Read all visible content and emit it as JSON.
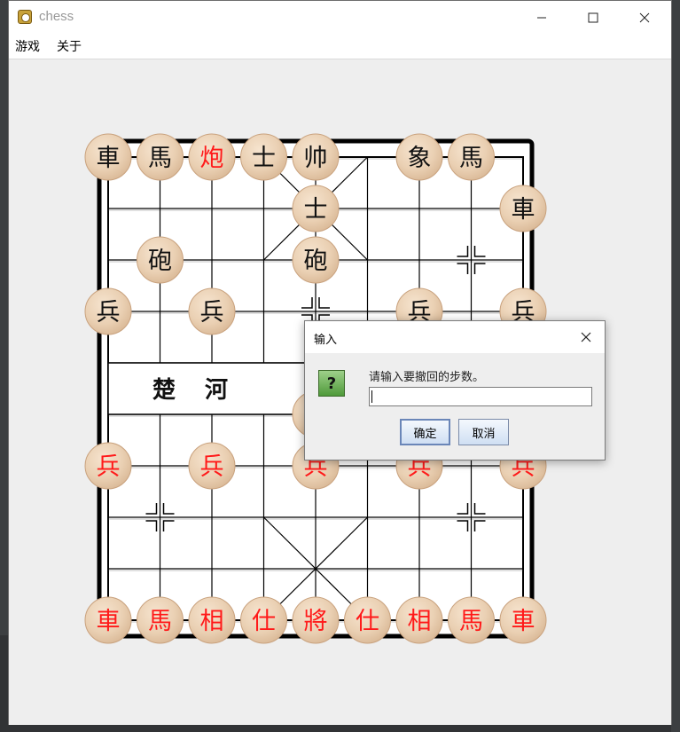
{
  "window": {
    "title": "chess",
    "menu": [
      "游戏",
      "关于"
    ]
  },
  "board": {
    "river_text_left": "楚 河",
    "pieces": [
      {
        "label": "車",
        "color": "black",
        "col": 0,
        "row": 0
      },
      {
        "label": "馬",
        "color": "black",
        "col": 1,
        "row": 0
      },
      {
        "label": "炮",
        "color": "red",
        "col": 2,
        "row": 0
      },
      {
        "label": "士",
        "color": "black",
        "col": 3,
        "row": 0
      },
      {
        "label": "帅",
        "color": "black",
        "col": 4,
        "row": 0
      },
      {
        "label": "象",
        "color": "black",
        "col": 6,
        "row": 0
      },
      {
        "label": "馬",
        "color": "black",
        "col": 7,
        "row": 0
      },
      {
        "label": "士",
        "color": "black",
        "col": 4,
        "row": 1
      },
      {
        "label": "車",
        "color": "black",
        "col": 8,
        "row": 1
      },
      {
        "label": "砲",
        "color": "black",
        "col": 1,
        "row": 2
      },
      {
        "label": "砲",
        "color": "black",
        "col": 4,
        "row": 2
      },
      {
        "label": "兵",
        "color": "black",
        "col": 0,
        "row": 3
      },
      {
        "label": "兵",
        "color": "black",
        "col": 2,
        "row": 3
      },
      {
        "label": "兵",
        "color": "black",
        "col": 6,
        "row": 3
      },
      {
        "label": "兵",
        "color": "black",
        "col": 8,
        "row": 3
      },
      {
        "label": "炮",
        "color": "red",
        "col": 4,
        "row": 5
      },
      {
        "label": "兵",
        "color": "red",
        "col": 0,
        "row": 6
      },
      {
        "label": "兵",
        "color": "red",
        "col": 2,
        "row": 6
      },
      {
        "label": "兵",
        "color": "red",
        "col": 4,
        "row": 6
      },
      {
        "label": "兵",
        "color": "red",
        "col": 6,
        "row": 6
      },
      {
        "label": "兵",
        "color": "red",
        "col": 8,
        "row": 6
      },
      {
        "label": "車",
        "color": "red",
        "col": 0,
        "row": 9
      },
      {
        "label": "馬",
        "color": "red",
        "col": 1,
        "row": 9
      },
      {
        "label": "相",
        "color": "red",
        "col": 2,
        "row": 9
      },
      {
        "label": "仕",
        "color": "red",
        "col": 3,
        "row": 9
      },
      {
        "label": "將",
        "color": "red",
        "col": 4,
        "row": 9
      },
      {
        "label": "仕",
        "color": "red",
        "col": 5,
        "row": 9
      },
      {
        "label": "相",
        "color": "red",
        "col": 6,
        "row": 9
      },
      {
        "label": "馬",
        "color": "red",
        "col": 7,
        "row": 9
      },
      {
        "label": "車",
        "color": "red",
        "col": 8,
        "row": 9
      }
    ],
    "markers": [
      {
        "col": 7,
        "row": 2
      },
      {
        "col": 4,
        "row": 3
      },
      {
        "col": 1,
        "row": 7
      },
      {
        "col": 7,
        "row": 7
      }
    ],
    "colors": {
      "red": "#ff1a1a",
      "black": "#111111",
      "piece_fill": "#ecd1b4"
    }
  },
  "dialog": {
    "title": "输入",
    "prompt": "请输入要撤回的步数。",
    "input_value": "",
    "ok_label": "确定",
    "cancel_label": "取消"
  }
}
